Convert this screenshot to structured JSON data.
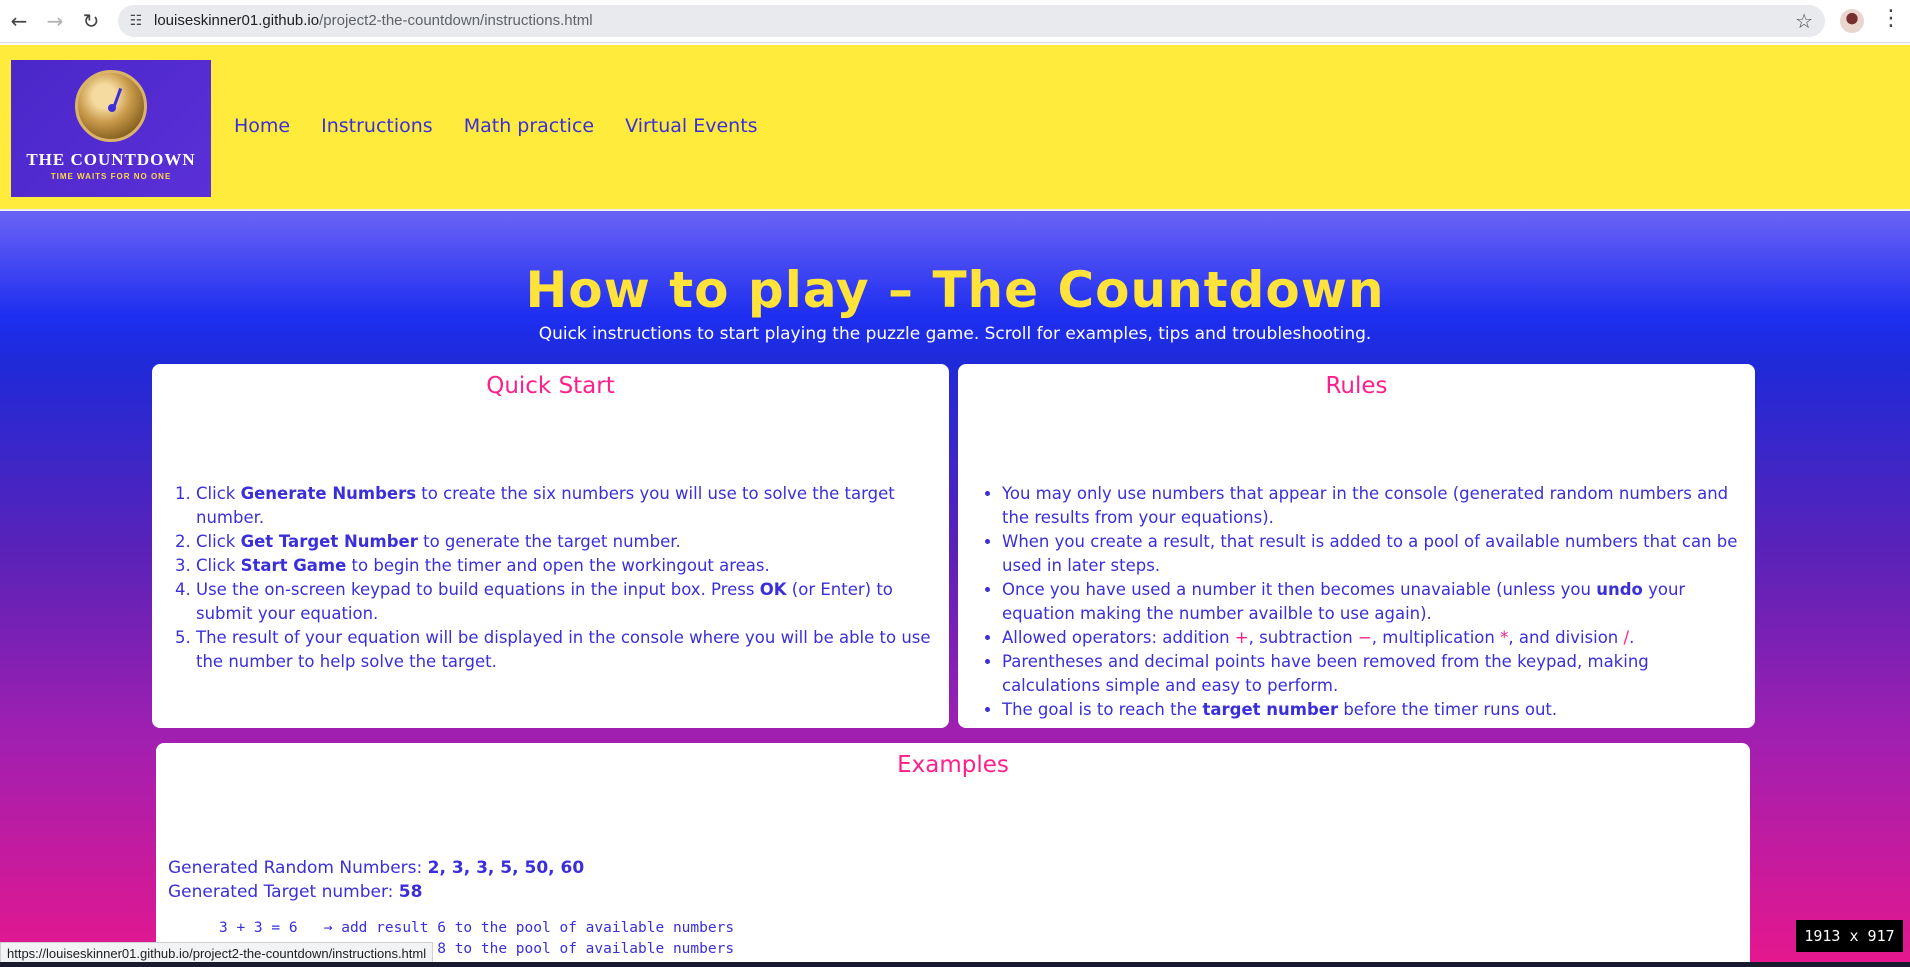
{
  "browser": {
    "url_host": "louiseskinner01.github.io",
    "url_path": "/project2-the-countdown/instructions.html",
    "status_url": "https://louiseskinner01.github.io/project2-the-countdown/instructions.html",
    "dimensions_badge": "1913 x 917"
  },
  "header": {
    "logo_title": "THE COUNTDOWN",
    "logo_subtitle": "TIME WAITS FOR NO ONE",
    "nav": [
      "Home",
      "Instructions",
      "Math practice",
      "Virtual Events"
    ]
  },
  "hero": {
    "title": "How to play – The Countdown",
    "subtitle": "Quick instructions to start playing the puzzle game. Scroll for examples, tips and troubleshooting."
  },
  "quick_start": {
    "heading": "Quick Start",
    "items": [
      {
        "pre": "Click ",
        "bold": "Generate Numbers",
        "post": " to create the six numbers you will use to solve the target number."
      },
      {
        "pre": "Click ",
        "bold": "Get Target Number",
        "post": " to generate the target number."
      },
      {
        "pre": "Click ",
        "bold": "Start Game",
        "post": " to begin the timer and open the workingout areas."
      },
      {
        "pre": "Use the on-screen keypad to build equations in the input box. Press ",
        "bold": "OK",
        "post": " (or Enter) to submit your equation."
      },
      {
        "pre": "The result of your equation will be displayed in the console where you will be able to use the number to help solve the target.",
        "bold": "",
        "post": ""
      }
    ]
  },
  "rules": {
    "heading": "Rules",
    "item1": "You may only use numbers that appear in the console (generated random numbers and the results from your equations).",
    "item2": "When you create a result, that result is added to a pool of available numbers that can be used in later steps.",
    "item3_pre": "Once you have used a number it then becomes unavaiable (unless you ",
    "item3_bold": "undo",
    "item3_post": " your equation making the number availble to use again).",
    "item4_pre": "Allowed operators: addition ",
    "op_add": "+",
    "item4_mid1": ", subtraction ",
    "op_sub": "−",
    "item4_mid2": ", multiplication ",
    "op_mul": "*",
    "item4_mid3": ", and division ",
    "op_div": "/",
    "item4_post": ".",
    "item5": "Parentheses and decimal points have been removed from the keypad, making calculations simple and easy to perform.",
    "item6_pre": "The goal is to reach the ",
    "item6_bold": "target number",
    "item6_post": " before the timer runs out."
  },
  "examples": {
    "heading": "Examples",
    "random_label": "Generated Random Numbers: ",
    "random_values": "2, 3, 3, 5, 50, 60",
    "target_label": "Generated Target number: ",
    "target_value": "58",
    "steps": [
      "3 + 3 = 6   → add result 6 to the pool of available numbers",
      "6 + 2 = 8   → add result 8 to the pool of available numbers"
    ]
  }
}
